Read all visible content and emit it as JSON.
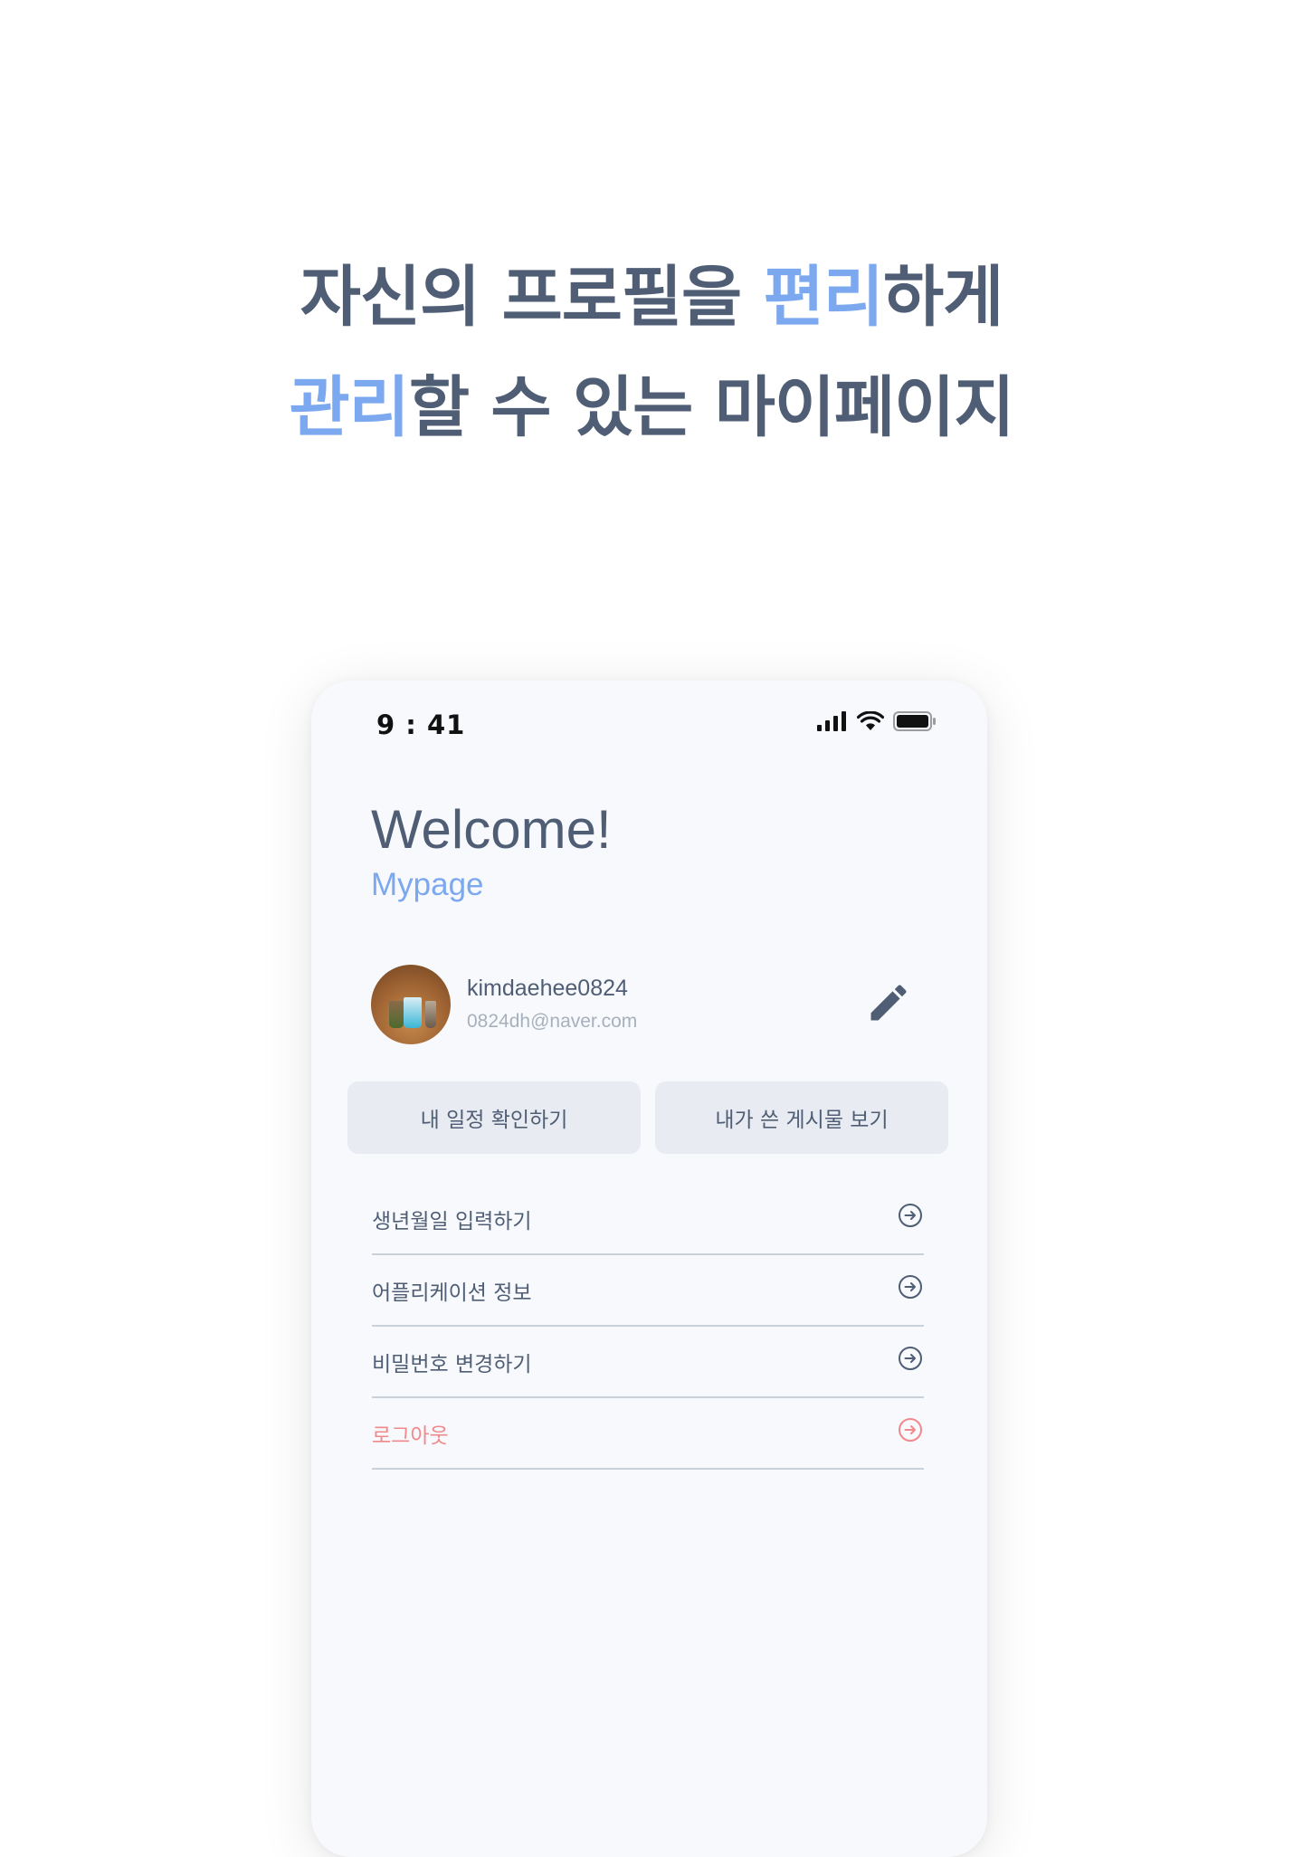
{
  "headline": {
    "line1_pre": "자신의 프로필을 ",
    "line1_highlight": "편리",
    "line1_post": "하게",
    "line2_highlight": "관리",
    "line2_post": "할 수 있는 마이페이지"
  },
  "status_bar": {
    "time": "9 : 41",
    "icons": [
      "signal-icon",
      "wifi-icon",
      "battery-icon"
    ]
  },
  "page": {
    "title": "Welcome!",
    "subtitle": "Mypage"
  },
  "profile": {
    "username": "kimdaehee0824",
    "email": "0824dh@naver.com",
    "edit_icon": "pencil-icon"
  },
  "actions": {
    "schedule_label": "내 일정 확인하기",
    "posts_label": "내가 쓴 게시물 보기"
  },
  "menu": {
    "items": [
      {
        "label": "생년월일 입력하기"
      },
      {
        "label": "어플리케이션 정보"
      },
      {
        "label": "비밀번호 변경하기"
      },
      {
        "label": "로그아웃"
      }
    ]
  },
  "colors": {
    "primary_text": "#4f5e75",
    "accent": "#7ca8ef",
    "danger": "#f0898c",
    "button_bg": "#e8ecf2",
    "screen_bg": "#f7f9fc"
  }
}
